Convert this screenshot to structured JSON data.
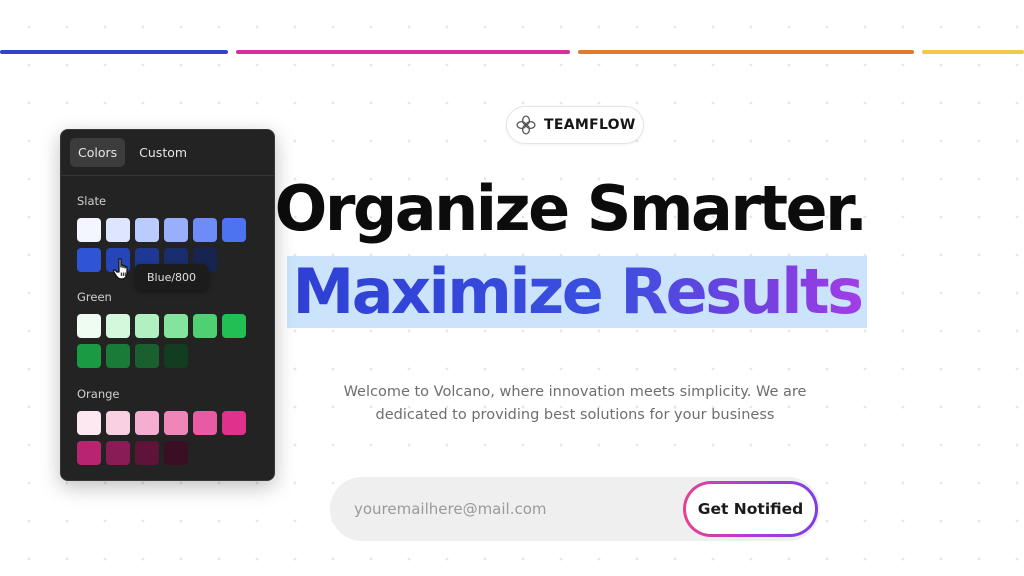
{
  "top_bars": [
    "#2f44c8",
    "#d92f9e",
    "#e07b2e",
    "#f2c94c"
  ],
  "brand": {
    "name": "TEAMFLOW",
    "logo_icon": "flower-logo-icon"
  },
  "hero": {
    "headline_1": "Organize Smarter.",
    "headline_2": "Maximize Results",
    "subtitle_line_1": "Welcome to Volcano, where innovation meets simplicity. We are",
    "subtitle_line_2": "dedicated to providing best solutions for your business"
  },
  "signup": {
    "email_placeholder": "youremailhere@mail.com",
    "button_label": "Get Notified"
  },
  "color_panel": {
    "tabs": [
      {
        "label": "Colors",
        "active": true
      },
      {
        "label": "Custom",
        "active": false
      }
    ],
    "groups": [
      {
        "name": "Slate",
        "swatches": [
          "#f4f6ff",
          "#dde5ff",
          "#bccbff",
          "#9aaffc",
          "#6e8cf7",
          "#4d73f0",
          "#2f54d6",
          "#2545b8",
          "#1e3893",
          "#1a2e6f",
          "#17244f"
        ]
      },
      {
        "name": "Green",
        "swatches": [
          "#eefcf1",
          "#d4f8dc",
          "#b1f0c0",
          "#84e39c",
          "#4fd173",
          "#22bf55",
          "#1a9b43",
          "#1a7a37",
          "#1a5f2e",
          "#123d1e"
        ]
      },
      {
        "name": "Orange",
        "swatches": [
          "#fde8f1",
          "#f9cfe2",
          "#f4aed0",
          "#ee86ba",
          "#e85aa2",
          "#e0328c",
          "#b8246f",
          "#8a1c55",
          "#5e1439",
          "#3a0f24"
        ]
      }
    ],
    "tooltip": "Blue/800",
    "cursor_icon": "hand-pointer-icon"
  }
}
